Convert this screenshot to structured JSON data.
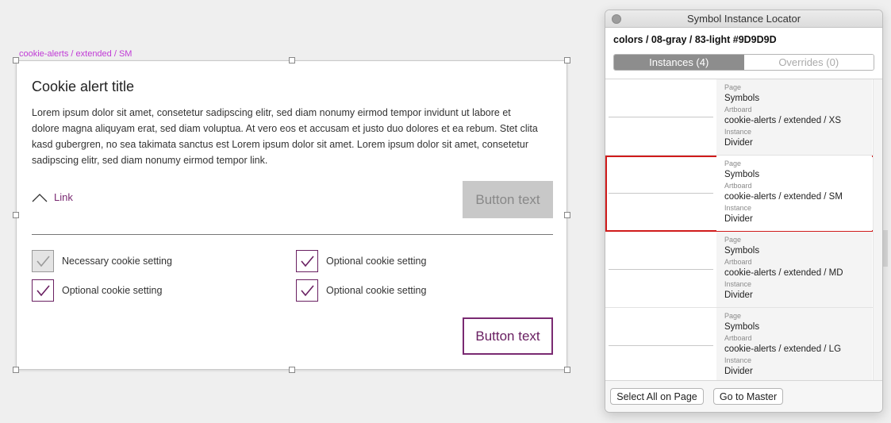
{
  "artboard": {
    "label": "cookie-alerts / extended / SM",
    "title": "Cookie alert title",
    "body": "Lorem ipsum dolor sit amet, consetetur sadipscing elitr, sed diam nonumy eirmod tempor invidunt ut labore et dolore magna aliquyam erat, sed diam voluptua. At vero eos et accusam et justo duo dolores et ea rebum. Stet clita kasd gubergren, no sea takimata sanctus est Lorem ipsum dolor sit amet. Lorem ipsum dolor sit amet, consetetur sadipscing elitr, sed diam nonumy eirmod tempor link.",
    "link_label": "Link",
    "top_button": "Button text",
    "bottom_button": "Button text",
    "checkboxes": [
      {
        "label": "Necessary cookie setting",
        "checked": true,
        "disabled": true
      },
      {
        "label": "Optional cookie setting",
        "checked": true,
        "disabled": false
      },
      {
        "label": "Optional cookie setting",
        "checked": true,
        "disabled": false
      },
      {
        "label": "Optional cookie setting",
        "checked": true,
        "disabled": false
      }
    ],
    "colors": {
      "accent": "#7a2a72",
      "label": "#c03bd6",
      "disabled_button": "#c8c8c8"
    }
  },
  "panel": {
    "title": "Symbol Instance Locator",
    "subtitle": "colors / 08-gray / 83-light #9D9D9D",
    "tabs": [
      {
        "label": "Instances (4)",
        "active": true
      },
      {
        "label": "Overrides (0)",
        "active": false
      }
    ],
    "field_labels": {
      "page": "Page",
      "artboard": "Artboard",
      "instance": "Instance"
    },
    "instances": [
      {
        "page": "Symbols",
        "artboard": "cookie-alerts / extended / XS",
        "instance": "Divider",
        "selected": false
      },
      {
        "page": "Symbols",
        "artboard": "cookie-alerts / extended / SM",
        "instance": "Divider",
        "selected": true
      },
      {
        "page": "Symbols",
        "artboard": "cookie-alerts / extended / MD",
        "instance": "Divider",
        "selected": false
      },
      {
        "page": "Symbols",
        "artboard": "cookie-alerts / extended / LG",
        "instance": "Divider",
        "selected": false
      }
    ],
    "footer": {
      "select_all": "Select All on Page",
      "go_to_master": "Go to Master"
    },
    "colors": {
      "selection": "#d01b1b",
      "tab_active": "#8d8d8d"
    }
  }
}
